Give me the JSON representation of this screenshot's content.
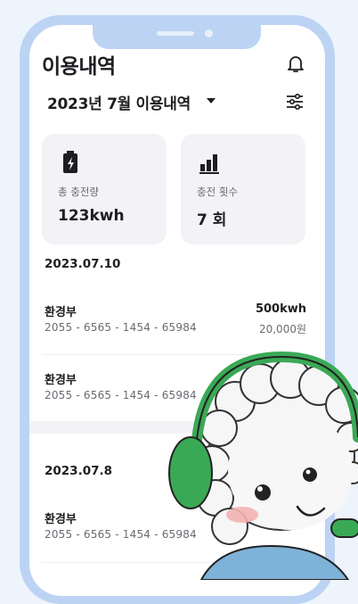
{
  "header": {
    "title": "이용내역",
    "month_label": "2023년 7월 이용내역"
  },
  "icons": {
    "bell": "bell-icon",
    "filter": "filter-sliders-icon",
    "dropdown": "caret-down-icon",
    "battery": "battery-charging-icon",
    "chart": "bar-chart-icon"
  },
  "stats": [
    {
      "label": "총 충전량",
      "value": "123kwh"
    },
    {
      "label": "충전 횟수",
      "value": "7 회"
    }
  ],
  "groups": [
    {
      "date": "2023.07.10",
      "items": [
        {
          "name": "환경부",
          "number": "2055 - 6565 - 1454 - 65984",
          "kwh": "500kwh",
          "price": "20,000원"
        },
        {
          "name": "환경부",
          "number": "2055 - 6565 - 1454 - 65984"
        }
      ]
    },
    {
      "date": "2023.07.8",
      "items": [
        {
          "name": "환경부",
          "number": "2055 - 6565 - 1454 - 65984"
        }
      ]
    }
  ],
  "colors": {
    "frame": "#bcd3f4",
    "card": "#f3f3f7",
    "mascot_headphone": "#3aa956"
  }
}
